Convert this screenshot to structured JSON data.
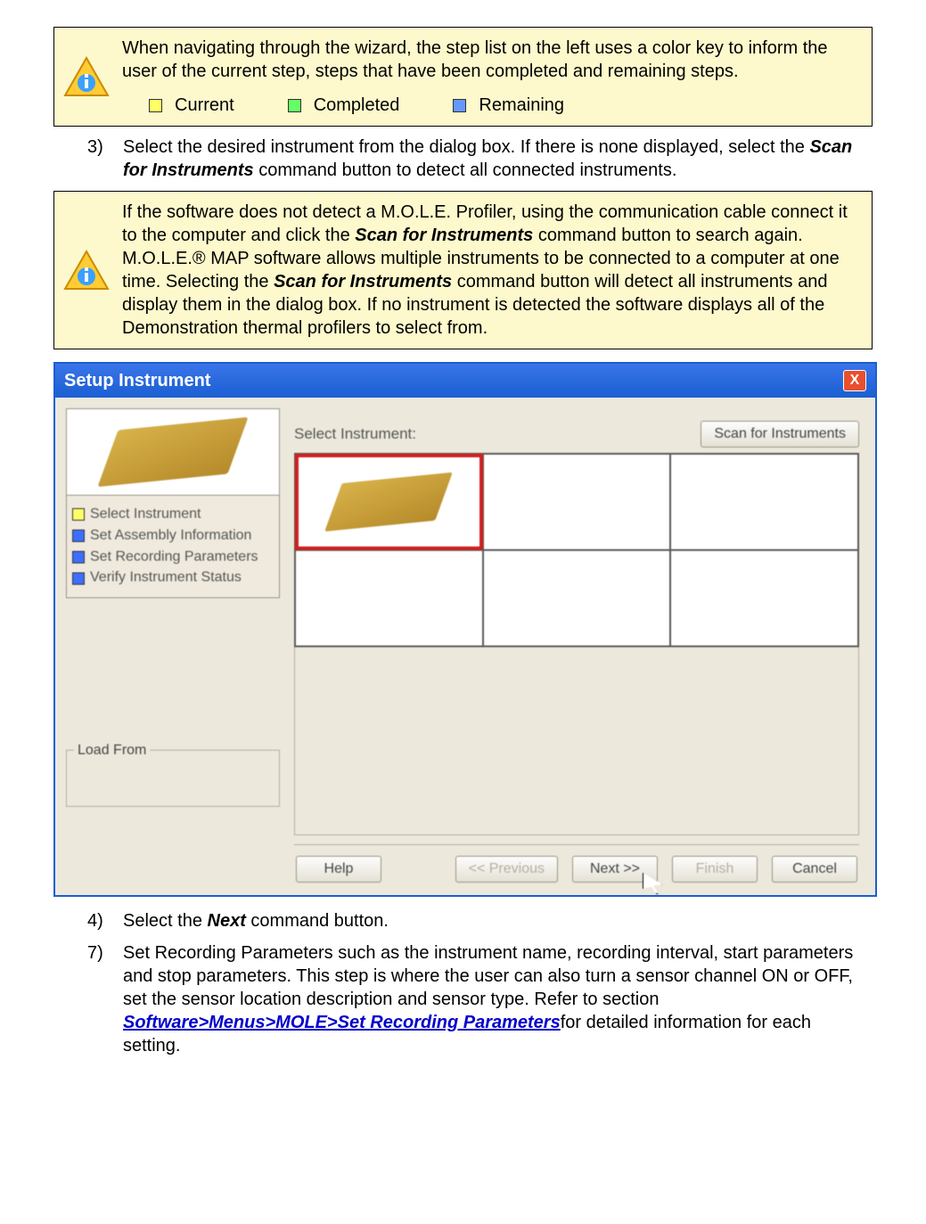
{
  "note1": {
    "text": "When navigating through the wizard, the step list on the left uses a color key to inform the user of the current step, steps that have been completed and remaining steps.",
    "legend": {
      "current": "Current",
      "completed": "Completed",
      "remaining": "Remaining"
    }
  },
  "step3": {
    "num": "3)",
    "text_a": "Select the desired instrument from the dialog box. If there is none displayed, select the ",
    "bold": "Scan for Instruments",
    "text_b": " command button to detect all connected instruments."
  },
  "note2": {
    "a": "If the software does not detect a M.O.L.E. Profiler, using the communication cable connect it to the computer and click the ",
    "b1": "Scan for Instruments",
    "c": " command button to search again. M.O.L.E.® MAP software allows multiple instruments to be connected to a computer at one time. Selecting the ",
    "b2": "Scan for Instruments",
    "d": " command button will detect all instruments and display them in the dialog box. If no instrument is detected the software displays all of the Demonstration thermal profilers to select from."
  },
  "dialog": {
    "title": "Setup Instrument",
    "select_label": "Select Instrument:",
    "scan_btn": "Scan for Instruments",
    "steps": [
      "Select Instrument",
      "Set Assembly Information",
      "Set Recording Parameters",
      "Verify Instrument Status"
    ],
    "load_from": "Load From",
    "buttons": {
      "help": "Help",
      "prev": "<< Previous",
      "next": "Next >>",
      "finish": "Finish",
      "cancel": "Cancel"
    }
  },
  "step4": {
    "num": "4)",
    "a": "Select the ",
    "b": "Next",
    "c": " command button."
  },
  "step7": {
    "num": "7)",
    "a": "Set Recording Parameters such as the instrument name, recording interval, start parameters and stop parameters. This step is where the user can also turn a sensor channel ON or OFF, set the sensor location description and sensor type. Refer to section   ",
    "link": "Software>Menus>MOLE>Set Recording Parameters",
    "b": "for detailed information for each setting."
  }
}
